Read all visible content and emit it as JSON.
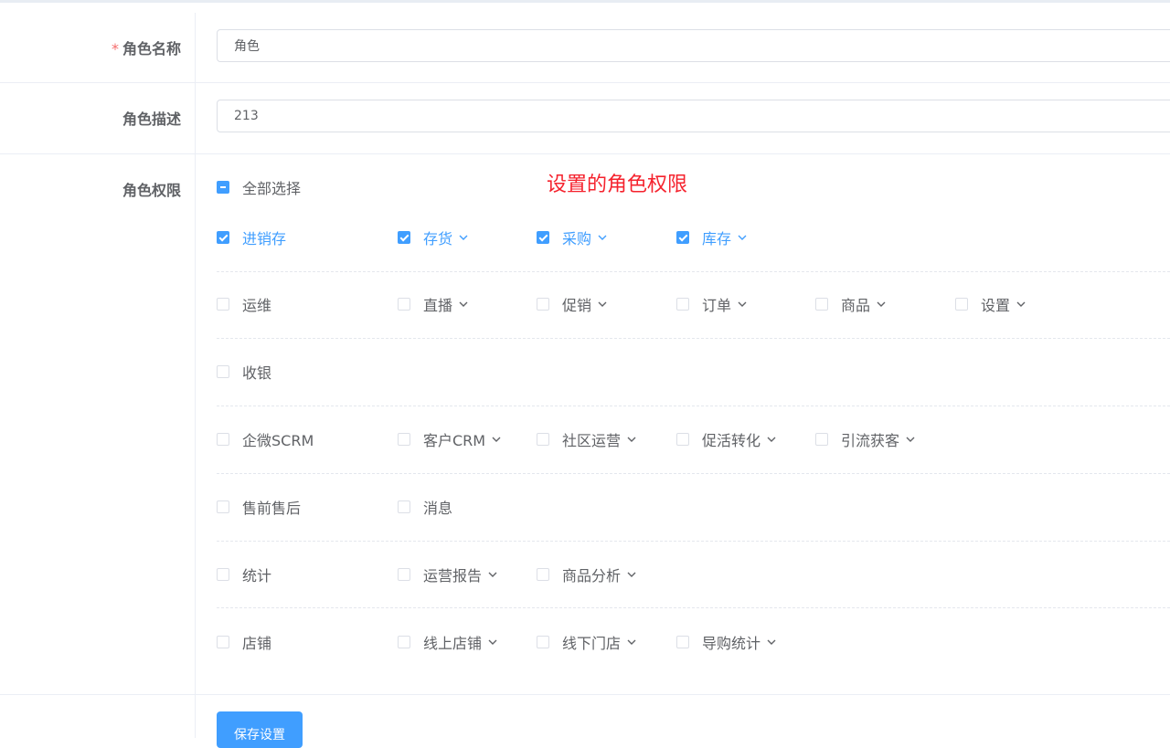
{
  "form": {
    "role_name": {
      "label": "角色名称",
      "required_mark": "*",
      "value": "角色"
    },
    "role_desc": {
      "label": "角色描述",
      "value": "213"
    },
    "permissions": {
      "label": "角色权限",
      "select_all": "全部选择",
      "annotation": "设置的角色权限",
      "groups": [
        {
          "label": "进销存",
          "checked": true,
          "children": [
            {
              "label": "存货",
              "checked": true
            },
            {
              "label": "采购",
              "checked": true
            },
            {
              "label": "库存",
              "checked": true
            }
          ]
        },
        {
          "label": "运维",
          "checked": false,
          "children": [
            {
              "label": "直播",
              "checked": false
            },
            {
              "label": "促销",
              "checked": false
            },
            {
              "label": "订单",
              "checked": false
            },
            {
              "label": "商品",
              "checked": false
            },
            {
              "label": "设置",
              "checked": false
            }
          ]
        },
        {
          "label": "收银",
          "checked": false,
          "children": []
        },
        {
          "label": "企微SCRM",
          "checked": false,
          "children": [
            {
              "label": "客户CRM",
              "checked": false
            },
            {
              "label": "社区运营",
              "checked": false
            },
            {
              "label": "促活转化",
              "checked": false
            },
            {
              "label": "引流获客",
              "checked": false
            }
          ]
        },
        {
          "label": "售前售后",
          "checked": false,
          "children": [
            {
              "label": "消息",
              "checked": false
            }
          ]
        },
        {
          "label": "统计",
          "checked": false,
          "children": [
            {
              "label": "运营报告",
              "checked": false
            },
            {
              "label": "商品分析",
              "checked": false
            }
          ]
        },
        {
          "label": "店铺",
          "checked": false,
          "children": [
            {
              "label": "线上店铺",
              "checked": false
            },
            {
              "label": "线下门店",
              "checked": false
            },
            {
              "label": "导购统计",
              "checked": false
            }
          ]
        }
      ]
    },
    "save_label": "保存设置"
  },
  "colors": {
    "accent": "#409eff",
    "required": "#f56c6c",
    "annotation": "#f5222d"
  }
}
